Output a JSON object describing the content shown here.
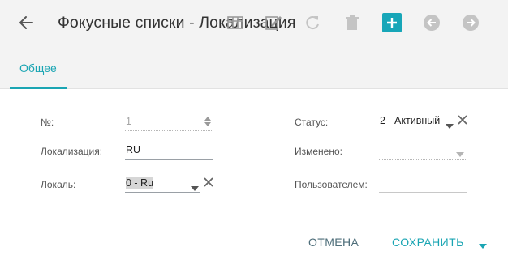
{
  "header": {
    "title": "Фокусные списки - Локализация",
    "toolbar_icons": [
      "table-icon",
      "edit-icon",
      "refresh-icon",
      "trash-icon",
      "add-icon",
      "arrow-left-circle-icon",
      "arrow-right-circle-icon"
    ]
  },
  "tabs": [
    {
      "label": "Общее",
      "active": true
    }
  ],
  "form": {
    "number": {
      "label": "№:",
      "value": "1"
    },
    "localization": {
      "label": "Локализация:",
      "value": "RU"
    },
    "locale": {
      "label": "Локаль:",
      "value": "0 - Ru"
    },
    "status": {
      "label": "Статус:",
      "value": "2 - Активный"
    },
    "changed": {
      "label": "Изменено:",
      "value": ""
    },
    "user": {
      "label": "Пользователем:",
      "value": ""
    }
  },
  "footer": {
    "cancel_label": "ОТМЕНА",
    "save_label": "СОХРАНИТЬ"
  },
  "colors": {
    "accent": "#1aa5b3",
    "header_bg": "#f3f3f3",
    "disabled_icon": "#c4c4c4"
  }
}
